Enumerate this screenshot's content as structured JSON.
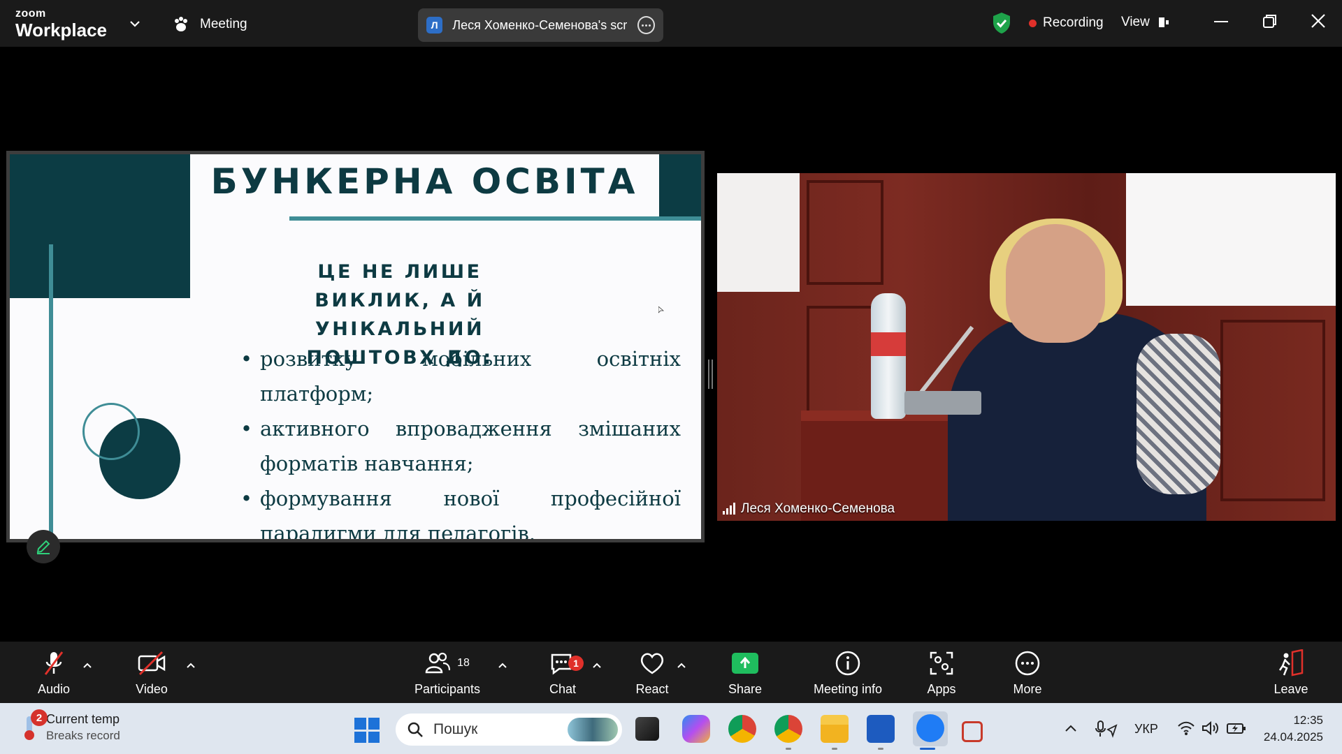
{
  "app": {
    "brand_top": "zoom",
    "brand_bottom": "Workplace",
    "meeting_label": "Meeting"
  },
  "share_pill": {
    "initial": "Л",
    "name": "Леся Хоменко-Семенова's scree"
  },
  "status": {
    "recording": "Recording",
    "view": "View"
  },
  "slide": {
    "title": "БУНКЕРНА ОСВІТА",
    "subtitle_line1": "ЦЕ НЕ ЛИШЕ ВИКЛИК, А Й",
    "subtitle_line2": "УНІКАЛЬНИЙ ПОШТОВХ ДО:",
    "bullets": [
      "розвитку мобільних освітніх платформ;",
      "активного впровадження змішаних форматів навчання;",
      "формування нової професійної парадигми для педагогів."
    ]
  },
  "video": {
    "participant_name": "Леся Хоменко-Семенова"
  },
  "toolbar": {
    "audio": "Audio",
    "video": "Video",
    "participants": "Participants",
    "participants_count": "18",
    "chat": "Chat",
    "chat_badge": "1",
    "react": "React",
    "share": "Share",
    "meeting_info": "Meeting info",
    "apps": "Apps",
    "more": "More",
    "leave": "Leave"
  },
  "taskbar": {
    "weather_badge": "2",
    "weather_title": "Current temp",
    "weather_sub": "Breaks record",
    "search_placeholder": "Пошук",
    "language": "УКР",
    "time": "12:35",
    "date": "24.04.2025"
  },
  "colors": {
    "slide_dark": "#0c3c44",
    "slide_accent": "#3f8d96",
    "recording_red": "#e0302a",
    "share_green": "#1fbd5e",
    "shield_green": "#1ea34a"
  }
}
